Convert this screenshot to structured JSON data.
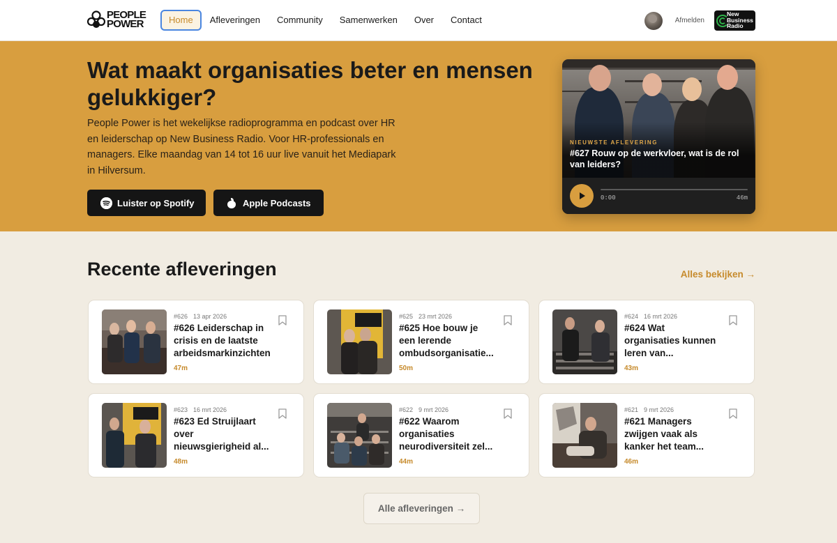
{
  "header": {
    "logo_text_line1": "PEOPLE",
    "logo_text_line2": "POWER",
    "nav": [
      {
        "label": "Home",
        "active": true
      },
      {
        "label": "Afleveringen"
      },
      {
        "label": "Community"
      },
      {
        "label": "Samenwerken"
      },
      {
        "label": "Over"
      },
      {
        "label": "Contact"
      }
    ],
    "logout_label": "Afmelden",
    "partner_logo_line1": "New",
    "partner_logo_line2": "Business",
    "partner_logo_line3": "Radio"
  },
  "hero": {
    "title": "Wat maakt organisaties beter en mensen gelukkiger?",
    "body": "People Power is het wekelijkse radioprogramma en podcast over HR en leiderschap op New Business Radio. Voor HR-professionals en managers. Elke maandag van 14 tot 16 uur live vanuit het Mediapark in Hilversum.",
    "spotify_label": "Luister op Spotify",
    "apple_label": "Apple Podcasts",
    "latest": {
      "kicker": "NIEUWSTE AFLEVERING",
      "title": "#627 Rouw op de werkvloer, wat is de rol van leiders?",
      "time_current": "0:00",
      "time_duration": "46m",
      "progress": 0
    }
  },
  "recent": {
    "title": "Recente afleveringen",
    "view_all": "Alles bekijken →",
    "episodes": [
      {
        "num": "#626",
        "date": "13 apr 2026",
        "title": "#626 Leiderschap in crisis en de laatste arbeidsmarkinzichten",
        "duration": "47m"
      },
      {
        "num": "#625",
        "date": "23 mrt 2026",
        "title": "#625 Hoe bouw je een lerende ombudsorganisatie...",
        "duration": "50m"
      },
      {
        "num": "#624",
        "date": "16 mrt 2026",
        "title": "#624 Wat organisaties kunnen leren van...",
        "duration": "43m"
      },
      {
        "num": "#623",
        "date": "16 mrt 2026",
        "title": "#623 Ed Struijlaart over nieuwsgierigheid al...",
        "duration": "48m"
      },
      {
        "num": "#622",
        "date": "9 mrt 2026",
        "title": "#622 Waarom organisaties neurodiversiteit zel...",
        "duration": "44m"
      },
      {
        "num": "#621",
        "date": "9 mrt 2026",
        "title": "#621 Managers zwijgen vaak als kanker het team...",
        "duration": "46m"
      }
    ],
    "all_button": "Alle afleveringen →"
  },
  "colors": {
    "accent": "#d89e3f",
    "accent_text": "#c68a2b",
    "background": "#f1ece2",
    "dark": "#151515"
  }
}
